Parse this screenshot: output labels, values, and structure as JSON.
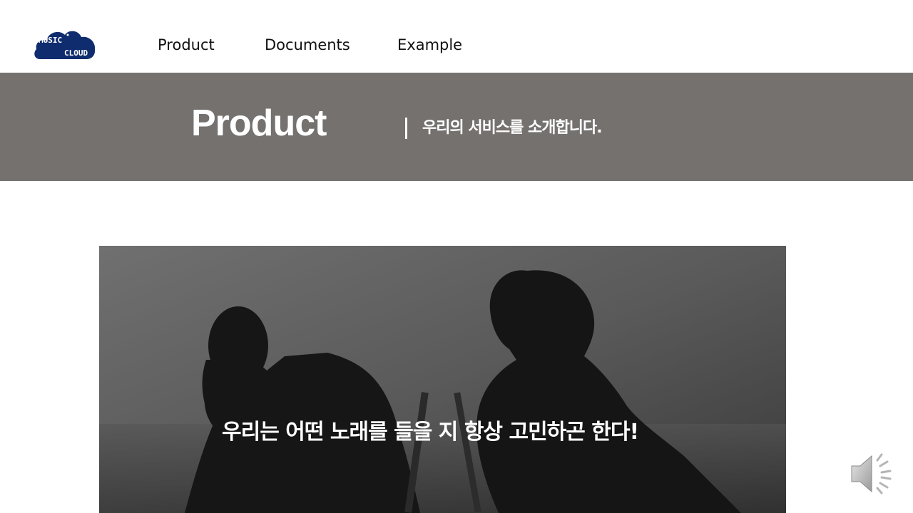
{
  "logo": {
    "line1": "MUSIC",
    "line2": "CLOUD",
    "brand_color": "#0f2d6e"
  },
  "nav": {
    "items": [
      {
        "label": "Product"
      },
      {
        "label": "Documents"
      },
      {
        "label": "Example"
      }
    ]
  },
  "banner": {
    "title": "Product",
    "subtitle": "우리의 서비스를 소개합니다.",
    "bg_color": "#75716f"
  },
  "hero": {
    "caption": "우리는 어떤 노래를 들을 지 항상 고민하곤 한다!"
  },
  "audio": {
    "icon": "speaker-icon"
  }
}
